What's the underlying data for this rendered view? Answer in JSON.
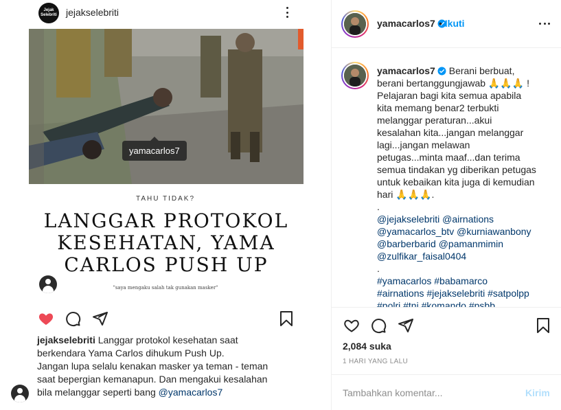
{
  "media": {
    "header": {
      "logo_text": "Jejak Selebriti",
      "username": "jejakselebriti"
    },
    "photo_tag": "yamacarlos7",
    "kicker": "TAHU TIDAK?",
    "headline": [
      "LANGGAR PROTOKOL",
      "KESEHATAN,  YAMA",
      "CARLOS PUSH UP"
    ],
    "quote": "\"saya mengaku salah tak gunakan masker\"",
    "caption": {
      "username": "jejakselebriti",
      "line1": " Langgar protokol kesehatan saat",
      "line2": "berkendara Yama Carlos dihukum Push Up.",
      "line3": "Jangan lupa selalu kenakan masker ya teman - teman",
      "line4": "saat bepergian kemanapun. Dan mengakui kesalahan",
      "line5": "bila melanggar seperti bang ",
      "mention": "@yamacarlos7"
    }
  },
  "panel": {
    "username": "yamacarlos7",
    "follow_separator": "•",
    "follow_label": "Ikuti",
    "caption": {
      "username": "yamacarlos7",
      "l1": " Berani berbuat,",
      "l2": "berani bertanggungjawab ",
      "l2_emoji": "🙏🙏🙏",
      "l2_end": " !",
      "l3": "Pelajaran bagi kita semua apabila",
      "l4": "kita memang benar2 terbukti",
      "l5": "melanggar peraturan...akui",
      "l6": "kesalahan kita...jangan melanggar",
      "l7": "lagi...jangan melawan",
      "l8": "petugas...minta maaf...dan terima",
      "l9": "semua tindakan yg diberikan petugas",
      "l10": "untuk kebaikan kita juga di kemudian",
      "l11": "hari ",
      "l11_emoji": "🙏🙏🙏",
      "l11_end": ".",
      "dot1": ".",
      "m1": "@jejakselebriti @airnations",
      "m2": "@yamacarlos_btv @kurniawanbony",
      "m3": "@barberbarid @pamanmimin",
      "m4": "@zulfikar_faisal0404",
      "dot2": ".",
      "h1": "#yamacarlos #babamarco",
      "h2": "#airnations #jejakselebriti #satpolpp",
      "h3": "#polri #tni #komando #psbb"
    },
    "likes": "2,084 suka",
    "time_ago": "1 HARI YANG LALU",
    "comment_placeholder": "Tambahkan komentar...",
    "send_label": "Kirim"
  },
  "icons": {
    "heart_filled": "heart-filled-icon",
    "heart_outline": "heart-outline-icon",
    "comment": "comment-icon",
    "share": "share-icon",
    "bookmark": "bookmark-icon",
    "more": "more-icon",
    "verified": "verified-badge-icon"
  },
  "colors": {
    "accent": "#0095f6",
    "like_red": "#ed4956",
    "mention": "#00376b",
    "muted": "#8e8e8e",
    "send_disabled": "#b2dffc"
  }
}
